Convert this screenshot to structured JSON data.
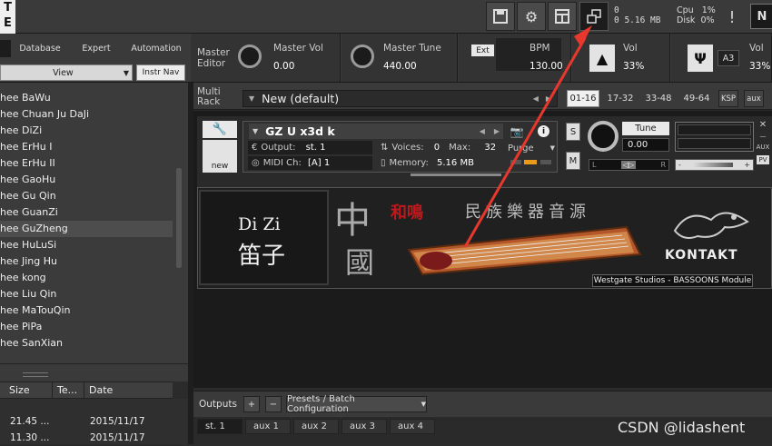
{
  "toolbar": {
    "logo_text": "T\nE",
    "status_voices": "0",
    "status_memory": "0  5.16 MB",
    "cpu_label": "Cpu",
    "cpu_value": "1%",
    "disk_label": "Disk",
    "disk_value": "0%",
    "warn_label": "!",
    "ni_label": "N"
  },
  "browser": {
    "tabs": [
      "Database",
      "Expert",
      "Automation"
    ],
    "view_label": "View",
    "instr_nav_label": "Instr Nav",
    "items": [
      "hee BaWu",
      "hee Chuan Ju DaJi",
      "hee DiZi",
      "hee ErHu I",
      "hee ErHu II",
      "hee GaoHu",
      "hee Gu Qin",
      "hee GuanZi",
      "hee GuZheng",
      "hee HuLuSi",
      "hee Jing Hu",
      "hee kong",
      "hee Liu Qin",
      "hee MaTouQin",
      "hee PiPa",
      "hee SanXian"
    ],
    "file_headers": [
      "Size",
      "Te...",
      "Date"
    ],
    "files": [
      {
        "size": "21.45 ...",
        "date": "2015/11/17"
      },
      {
        "size": "11.30 ...",
        "date": "2015/11/17"
      }
    ]
  },
  "master": {
    "editor_label": "Master\nEditor",
    "vol_label": "Master Vol",
    "vol_value": "0.00",
    "tune_label": "Master Tune",
    "tune_value": "440.00",
    "ext_label": "Ext",
    "bpm_label": "BPM",
    "bpm_value": "130.00",
    "vol2_label": "Vol",
    "vol2_value": "33%",
    "a3_label": "A3",
    "vol3_label": "Vol",
    "vol3_value": "33%"
  },
  "rack": {
    "multirack_label": "Multi\nRack",
    "preset_name": "New (default)",
    "pages": [
      "01-16",
      "17-32",
      "33-48",
      "49-64",
      "KSP",
      "aux"
    ]
  },
  "instrument": {
    "name": "GZ U x3d k",
    "output_label": "Output:",
    "output_value": "st. 1",
    "voices_label": "Voices:",
    "voices_value": "0",
    "max_label": "Max:",
    "max_value": "32",
    "purge_label": "Purge",
    "midi_label": "MIDI Ch:",
    "midi_value": "[A]  1",
    "memory_label": "Memory:",
    "memory_value": "5.16 MB",
    "s_label": "S",
    "m_label": "M",
    "tune_label": "Tune",
    "tune_value": "0.00",
    "pan_left": "L",
    "pan_right": "R",
    "vol_minus": "-",
    "vol_plus": "+",
    "new_label": "new",
    "aux_label": "AUX",
    "pv_label": "PV"
  },
  "banner": {
    "dizi_en": "Di Zi",
    "dizi_zh": "笛子",
    "china_1": "中",
    "china_2": "國",
    "red_text": "和鳴",
    "title_zh": "民族樂器音源",
    "kontakt": "KONTAKT",
    "credit": "Westgate Studios - BASSOONS Module"
  },
  "outputs": {
    "label": "Outputs",
    "presets_label": "Presets / Batch Configuration",
    "channels": [
      "st. 1",
      "aux 1",
      "aux 2",
      "aux 3",
      "aux 4"
    ]
  },
  "watermark": "CSDN @lidashent",
  "colors": {
    "arrow": "#e8382e",
    "accent_orange": "#e89a1a"
  }
}
